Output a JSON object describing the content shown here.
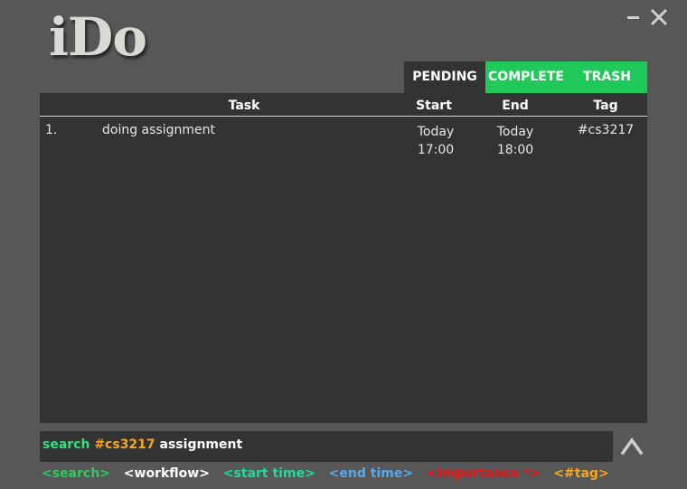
{
  "app": {
    "logo": "iDo"
  },
  "tabs": [
    {
      "label": "PENDING",
      "active": true
    },
    {
      "label": "COMPLETE",
      "active": false
    },
    {
      "label": "TRASH",
      "active": false
    }
  ],
  "table": {
    "headers": {
      "task": "Task",
      "start": "Start",
      "end": "End",
      "tag": "Tag"
    },
    "rows": [
      {
        "index": "1.",
        "task": "doing assignment",
        "start_day": "Today",
        "start_time": "17:00",
        "end_day": "Today",
        "end_time": "18:00",
        "tag": "#cs3217"
      }
    ]
  },
  "command": {
    "keyword": "search",
    "tag": "#cs3217",
    "text": "assignment"
  },
  "hints": {
    "search": "<search>",
    "workflow": "<workflow>",
    "start_time": "<start time>",
    "end_time": "<end time>",
    "importance": "<importance *>",
    "tag": "<#tag>"
  },
  "icons": {
    "minimize": "minimize-icon",
    "close": "close-icon",
    "up": "chevron-up-icon"
  },
  "colors": {
    "background": "#575757",
    "panel": "#333333",
    "accent_green": "#1fc95a",
    "tag_orange": "#f5a623"
  }
}
